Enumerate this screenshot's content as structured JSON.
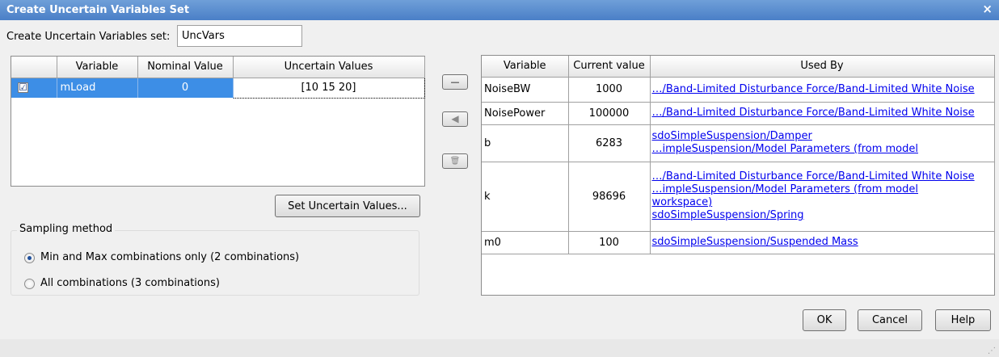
{
  "window": {
    "title": "Create Uncertain Variables Set",
    "close_glyph": "×"
  },
  "set_name": {
    "label": "Create Uncertain Variables set:",
    "value": "UncVars"
  },
  "uncertain_table": {
    "headers": [
      "",
      "Variable",
      "Nominal Value",
      "Uncertain Values"
    ],
    "rows": [
      {
        "checked": "☑",
        "variable": "mLoad",
        "nominal": "0",
        "uncertain": "[10 15 20]"
      }
    ]
  },
  "transfer_buttons": {
    "add_glyph": "—",
    "arrow_glyph": "◀",
    "delete_glyph": "🗑"
  },
  "set_values_button": "Set Uncertain Values...",
  "sampling": {
    "title": "Sampling method",
    "options": [
      {
        "label": "Min and Max combinations only (2 combinations)",
        "selected": true
      },
      {
        "label": "All combinations (3 combinations)",
        "selected": false
      }
    ]
  },
  "model_table": {
    "headers": [
      "Variable",
      "Current value",
      "Used By"
    ],
    "rows": [
      {
        "variable": "NoiseBW",
        "value": "1000",
        "used_by": [
          "…/Band-Limited Disturbance Force/Band-Limited White Noise"
        ]
      },
      {
        "variable": "NoisePower",
        "value": "100000",
        "used_by": [
          "…/Band-Limited Disturbance Force/Band-Limited White Noise"
        ]
      },
      {
        "variable": "b",
        "value": "6283",
        "used_by": [
          "sdoSimpleSuspension/Damper",
          "…impleSuspension/Model Parameters (from model"
        ]
      },
      {
        "variable": "k",
        "value": "98696",
        "used_by": [
          "…/Band-Limited Disturbance Force/Band-Limited White Noise",
          "…impleSuspension/Model Parameters (from model",
          "workspace)",
          "sdoSimpleSuspension/Spring"
        ]
      },
      {
        "variable": "m0",
        "value": "100",
        "used_by": [
          "sdoSimpleSuspension/Suspended Mass"
        ]
      }
    ]
  },
  "dialog_buttons": {
    "ok": "OK",
    "cancel": "Cancel",
    "help": "Help"
  },
  "colors": {
    "title_bar": "#4a7fc7",
    "selection": "#3d8ee6",
    "link": "#0000ee"
  }
}
